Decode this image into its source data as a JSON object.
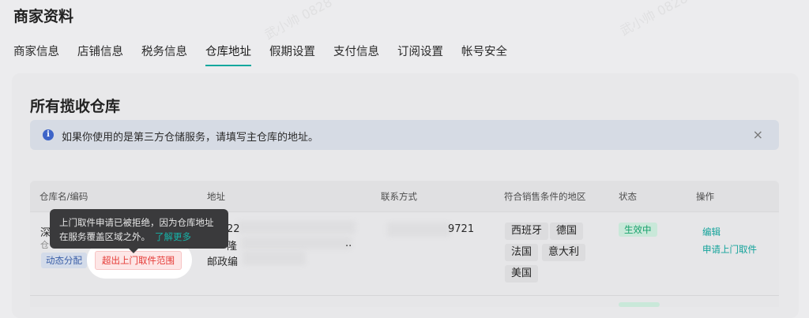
{
  "page": {
    "title": "商家资料"
  },
  "tabs": [
    {
      "label": "商家信息",
      "active": false
    },
    {
      "label": "店铺信息",
      "active": false
    },
    {
      "label": "税务信息",
      "active": false
    },
    {
      "label": "仓库地址",
      "active": true
    },
    {
      "label": "假期设置",
      "active": false
    },
    {
      "label": "支付信息",
      "active": false
    },
    {
      "label": "订阅设置",
      "active": false
    },
    {
      "label": "帐号安全",
      "active": false
    }
  ],
  "section": {
    "title": "所有揽收仓库"
  },
  "alert": {
    "icon": "info-icon",
    "text": "如果你使用的是第三方仓储服务，请填写主仓库的地址。",
    "close": "×"
  },
  "table": {
    "headers": [
      "仓库名/编码",
      "地址",
      "联系方式",
      "符合销售条件的地区",
      "状态",
      "操作"
    ],
    "row": {
      "name_partial": "深",
      "name_sub_partial": "仓",
      "address_line1_partial": "22",
      "address_line2_partial": "隆",
      "address_line3_partial": "邮政编",
      "address_dots": "..",
      "contact_partial": "9721",
      "tags": [
        "动态分配",
        "超出上门取件范围"
      ],
      "regions": [
        "西班牙",
        "德国",
        "法国",
        "意大利",
        "美国"
      ],
      "status": "生效中",
      "actions": [
        "编辑",
        "申请上门取件"
      ]
    }
  },
  "tooltip": {
    "line1": "上门取件申请已被拒绝，因为仓库地址",
    "line2": "在服务覆盖区域之外。",
    "link": "了解更多"
  },
  "watermark": "武小帅 0828",
  "colors": {
    "accent": "#13a89e",
    "danger": "#e53935",
    "success": "#16a06b",
    "info": "#3d64c8"
  }
}
